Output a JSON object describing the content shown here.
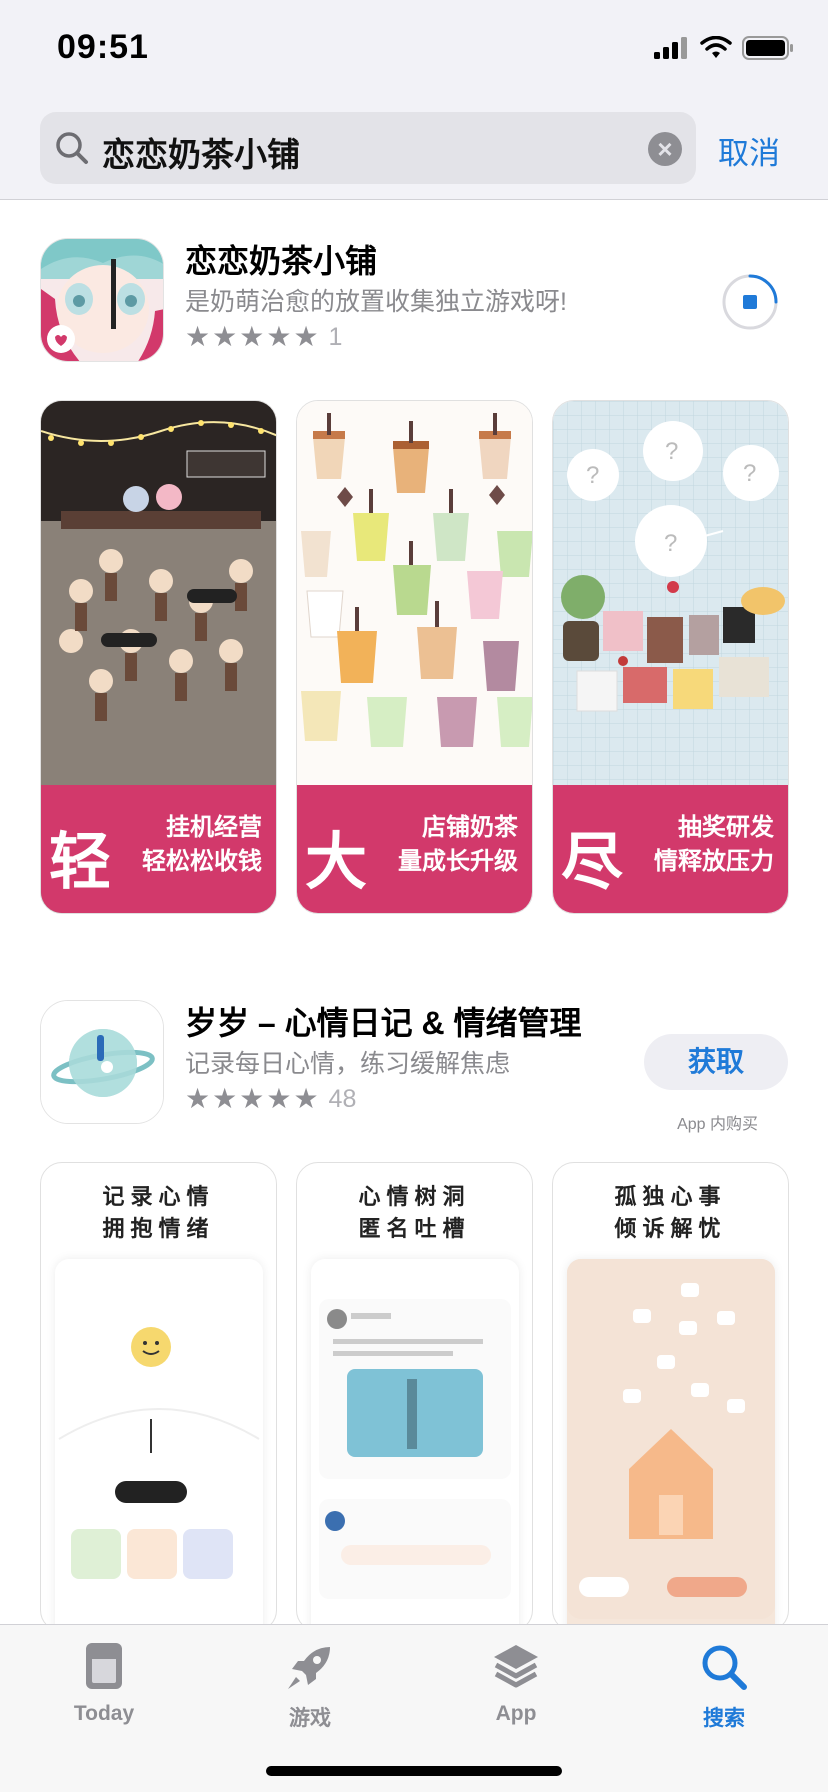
{
  "status": {
    "time": "09:51"
  },
  "search": {
    "query": "恋恋奶茶小铺",
    "cancel_label": "取消"
  },
  "results": [
    {
      "name": "恋恋奶茶小铺",
      "subtitle": "是奶萌治愈的放置收集独立游戏呀!",
      "rating_count": "1",
      "screenshots": [
        {
          "big": "轻",
          "line1": "挂机经营",
          "line2": "轻松松收钱"
        },
        {
          "big": "大",
          "line1": "店铺奶茶",
          "line2": "量成长升级"
        },
        {
          "big": "尽",
          "line1": "抽奖研发",
          "line2": "情释放压力"
        }
      ]
    },
    {
      "name": "岁岁 – 心情日记 & 情绪管理",
      "subtitle": "记录每日心情，练习缓解焦虑",
      "rating_count": "48",
      "get_label": "获取",
      "iap_label": "App 内购买",
      "screenshots": [
        {
          "line1": "记录心情",
          "line2": "拥抱情绪"
        },
        {
          "line1": "心情树洞",
          "line2": "匿名吐槽"
        },
        {
          "line1": "孤独心事",
          "line2": "倾诉解忧"
        }
      ]
    }
  ],
  "tabbar": {
    "today": "Today",
    "games": "游戏",
    "apps": "App",
    "search": "搜索"
  },
  "colors": {
    "accent": "#1f7ad8",
    "banner": "#d2396b"
  }
}
